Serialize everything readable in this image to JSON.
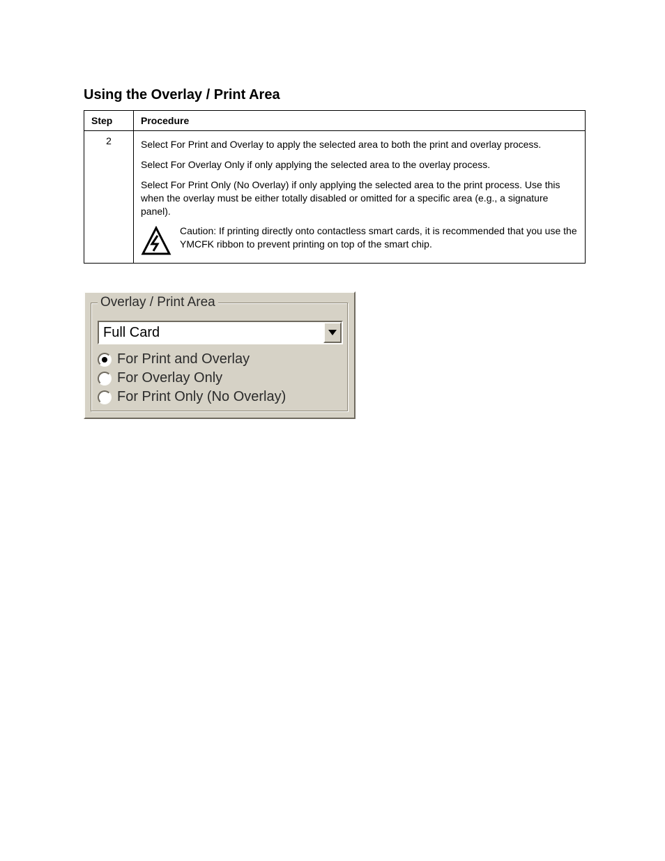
{
  "header_doc_title": "",
  "section_heading": "Using the Overlay / Print Area",
  "table": {
    "col_step": "Step",
    "col_proc": "Procedure",
    "rows": [
      {
        "step": "2",
        "paras": [
          "Select For Print and Overlay to apply the selected area to both the print and overlay process.",
          "Select For Overlay Only if only applying the selected area to the overlay process.",
          "Select For Print Only (No Overlay) if only applying the selected area to the print process. Use this when the overlay must be either totally disabled or omitted for a specific area (e.g., a signature panel)."
        ],
        "caution": "Caution: If printing directly onto contactless smart cards, it is recommended that you use the YMCFK ribbon to prevent printing on top of the smart chip."
      }
    ]
  },
  "groupbox": {
    "legend": "Overlay / Print Area",
    "select_value": "Full Card",
    "radios": [
      {
        "label": "For Print and Overlay",
        "selected": true
      },
      {
        "label": "For Overlay Only",
        "selected": false
      },
      {
        "label": "For Print Only (No Overlay)",
        "selected": false
      }
    ]
  },
  "footer": {
    "left": "",
    "right": ""
  }
}
